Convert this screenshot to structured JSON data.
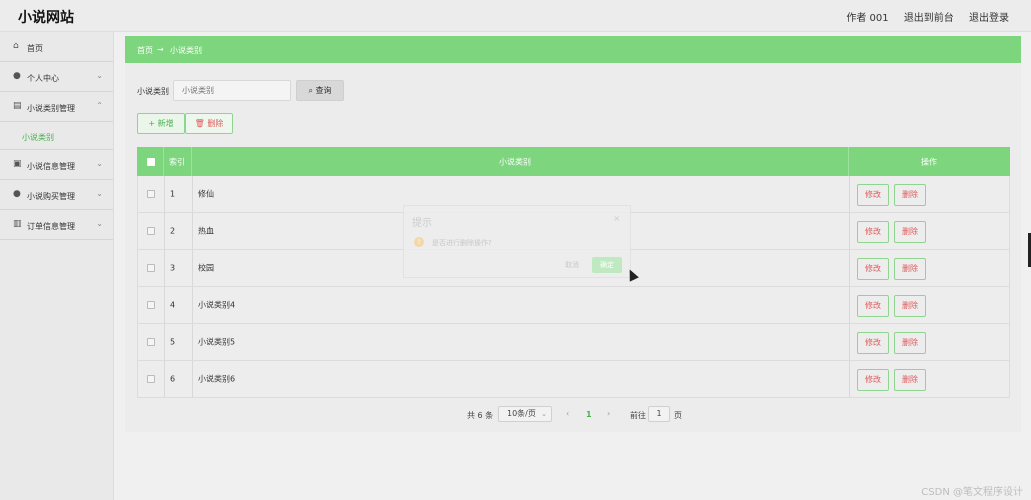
{
  "header": {
    "brand": "小说网站",
    "author": "作者 001",
    "back_front": "退出到前台",
    "logout": "退出登录"
  },
  "sidebar": {
    "items": [
      {
        "label": "首页",
        "icon": "home-icon"
      },
      {
        "label": "个人中心",
        "icon": "user-icon"
      },
      {
        "label": "小说类别管理",
        "icon": "folder-icon"
      },
      {
        "label": "小说信息管理",
        "icon": "book-icon"
      },
      {
        "label": "小说购买管理",
        "icon": "user-icon"
      },
      {
        "label": "订单信息管理",
        "icon": "bar-chart-icon"
      }
    ],
    "active_submenu": "小说类别"
  },
  "breadcrumb": {
    "home": "首页",
    "arrow": "→",
    "current": "小说类别"
  },
  "filter": {
    "label": "小说类别",
    "placeholder": "小说类别",
    "search": "查询"
  },
  "actions": {
    "add": "新增",
    "delete": "删除"
  },
  "table": {
    "headers": {
      "index": "索引",
      "category": "小说类别",
      "ops": "操作"
    },
    "rows": [
      {
        "index": "1",
        "name": "修仙"
      },
      {
        "index": "2",
        "name": "热血"
      },
      {
        "index": "3",
        "name": "校园"
      },
      {
        "index": "4",
        "name": "小说类别4"
      },
      {
        "index": "5",
        "name": "小说类别5"
      },
      {
        "index": "6",
        "name": "小说类别6"
      }
    ],
    "edit": "修改",
    "del": "删除"
  },
  "pager": {
    "total": "共 6 条",
    "size": "10条/页",
    "prev": "‹",
    "current": "1",
    "next": "›",
    "goto": "前往",
    "goto_value": "1",
    "unit": "页"
  },
  "dialog": {
    "title": "提示",
    "close": "×",
    "message": "是否进行删除操作?",
    "cancel": "取消",
    "ok": "确定"
  },
  "watermark": "CSDN @笔文程序设计",
  "colors": {
    "accent": "#7dd67e",
    "danger": "#e05a5a"
  }
}
